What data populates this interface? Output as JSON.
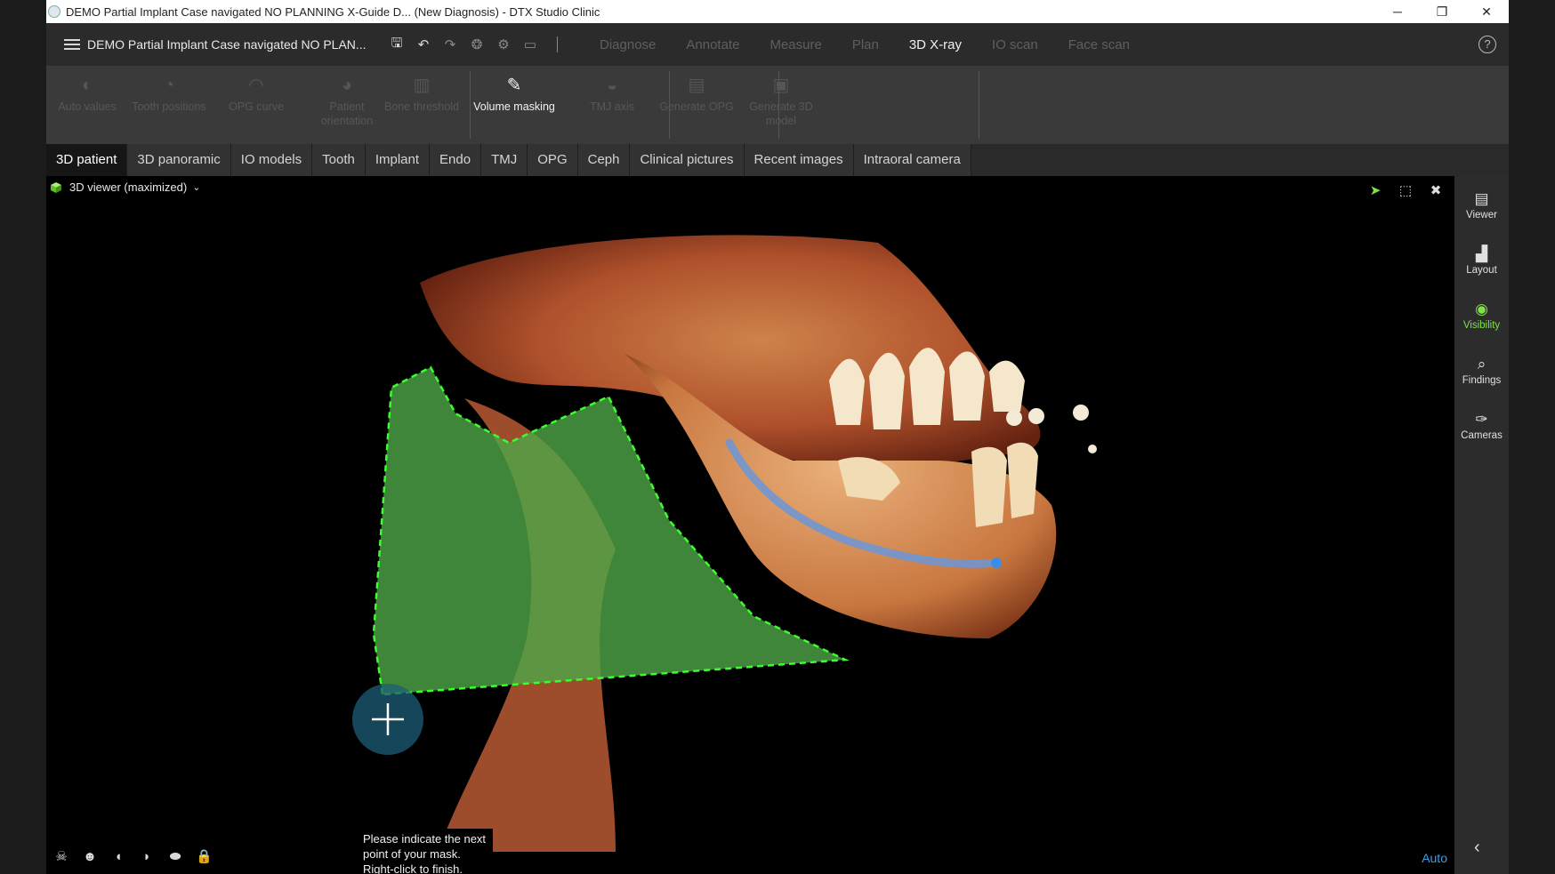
{
  "window": {
    "title": "DEMO Partial Implant Case navigated NO PLANNING X-Guide D... (New Diagnosis) - DTX Studio Clinic",
    "controls": {
      "minimize": "─",
      "restore": "❐",
      "close": "✕"
    }
  },
  "topbar": {
    "case_title": "DEMO Partial Implant Case navigated NO PLAN...",
    "quick_actions": [
      "save-icon",
      "undo-icon",
      "redo-icon",
      "tooth-icon",
      "settings-icon",
      "screen-icon"
    ],
    "nav": [
      {
        "label": "Diagnose",
        "active": false
      },
      {
        "label": "Annotate",
        "active": false
      },
      {
        "label": "Measure",
        "active": false
      },
      {
        "label": "Plan",
        "active": false
      },
      {
        "label": "3D X-ray",
        "active": true
      },
      {
        "label": "IO scan",
        "active": false
      },
      {
        "label": "Face scan",
        "active": false
      }
    ],
    "help": "?"
  },
  "ribbon": {
    "buttons": [
      {
        "label": "Auto values",
        "enabled": false
      },
      {
        "label": "Tooth positions",
        "enabled": false
      },
      {
        "label": "OPG curve",
        "enabled": false
      },
      {
        "label": "Patient orientation",
        "enabled": false
      },
      {
        "label": "Bone threshold",
        "enabled": false
      },
      {
        "label": "Volume masking",
        "enabled": true
      },
      {
        "label": "TMJ axis",
        "enabled": false
      },
      {
        "label": "Generate OPG",
        "enabled": false
      },
      {
        "label": "Generate 3D model",
        "enabled": false
      }
    ]
  },
  "tabs": [
    {
      "label": "3D patient",
      "active": true
    },
    {
      "label": "3D panoramic",
      "active": false
    },
    {
      "label": "IO models",
      "active": false
    },
    {
      "label": "Tooth",
      "active": false
    },
    {
      "label": "Implant",
      "active": false
    },
    {
      "label": "Endo",
      "active": false
    },
    {
      "label": "TMJ",
      "active": false
    },
    {
      "label": "OPG",
      "active": false
    },
    {
      "label": "Ceph",
      "active": false
    },
    {
      "label": "Clinical pictures",
      "active": false
    },
    {
      "label": "Recent images",
      "active": false
    },
    {
      "label": "Intraoral camera",
      "active": false
    }
  ],
  "viewer": {
    "label": "3D viewer (maximized)",
    "tools": [
      "select-cursor-icon",
      "fit-view-icon",
      "minimize-view-icon"
    ],
    "tooltip": "Please indicate the next point of your mask. Right-click to finish.",
    "render_mode": "Auto",
    "bottom_icons": [
      "skull-front-icon",
      "skull-side-icon",
      "skull-left-icon",
      "skull-right-icon",
      "skull-top-icon",
      "lock-icon"
    ],
    "colors": {
      "mask": "#4fa84a",
      "mask_outline": "#39ff2a",
      "bone": "#c86a3c",
      "nerve": "#5b8fd8"
    }
  },
  "sidebar": [
    {
      "label": "Viewer",
      "active": false
    },
    {
      "label": "Layout",
      "active": false
    },
    {
      "label": "Visibility",
      "active": true
    },
    {
      "label": "Findings",
      "active": false
    },
    {
      "label": "Cameras",
      "active": false
    }
  ]
}
